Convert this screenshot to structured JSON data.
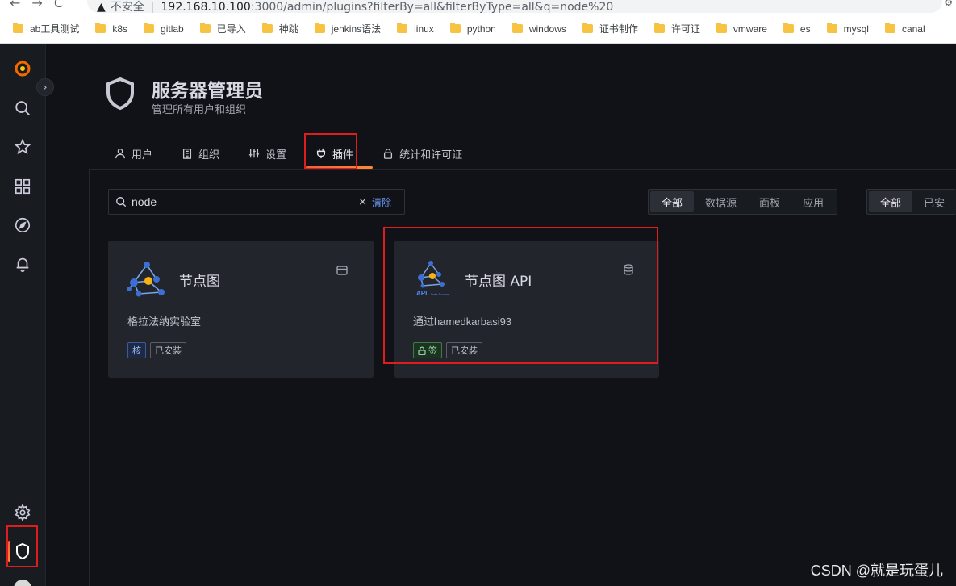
{
  "browser": {
    "insecure_label": "不安全",
    "url_host": "192.168.10.100",
    "url_path": ":3000/admin/plugins?filterBy=all&filterByType=all&q=node%20",
    "bookmarks": [
      "ab工具测试",
      "k8s",
      "gitlab",
      "已导入",
      "神跳",
      "jenkins语法",
      "linux",
      "python",
      "windows",
      "证书制作",
      "许可证",
      "vmware",
      "es",
      "mysql",
      "canal"
    ]
  },
  "sidebar": {
    "items": [
      "grafana-logo",
      "search-icon",
      "star-icon",
      "dashboards-icon",
      "explore-icon",
      "alerting-icon",
      "gear-icon",
      "shield-icon"
    ]
  },
  "header": {
    "title": "服务器管理员",
    "subtitle": "管理所有用户和组织"
  },
  "tabs": [
    {
      "label": "用户"
    },
    {
      "label": "组织"
    },
    {
      "label": "设置"
    },
    {
      "label": "插件",
      "active": true
    },
    {
      "label": "统计和许可证"
    }
  ],
  "search": {
    "value": "node",
    "clear_label": "清除"
  },
  "filter_by_type": {
    "options": [
      "全部",
      "数据源",
      "面板",
      "应用"
    ],
    "selected": "全部"
  },
  "filter_by": {
    "options": [
      "全部",
      "已安"
    ],
    "selected": "全部"
  },
  "plugins": [
    {
      "name": "节点图",
      "description": "格拉法纳实验室",
      "badges": [
        "核",
        "已安装"
      ],
      "type_icon": "panel-icon"
    },
    {
      "name": "节点图 API",
      "description": "通过hamedkarbasi93",
      "logo_text_main": "API",
      "logo_text_sub": "Data Source",
      "badges": [
        "签",
        "已安装"
      ],
      "type_icon": "database-icon"
    }
  ],
  "watermark": "CSDN @就是玩蛋儿",
  "colors": {
    "accent_gradient_start": "#f55f3e",
    "accent_gradient_end": "#ff8833",
    "highlight_box": "#e01d1d",
    "link_blue": "#6e9fff"
  }
}
